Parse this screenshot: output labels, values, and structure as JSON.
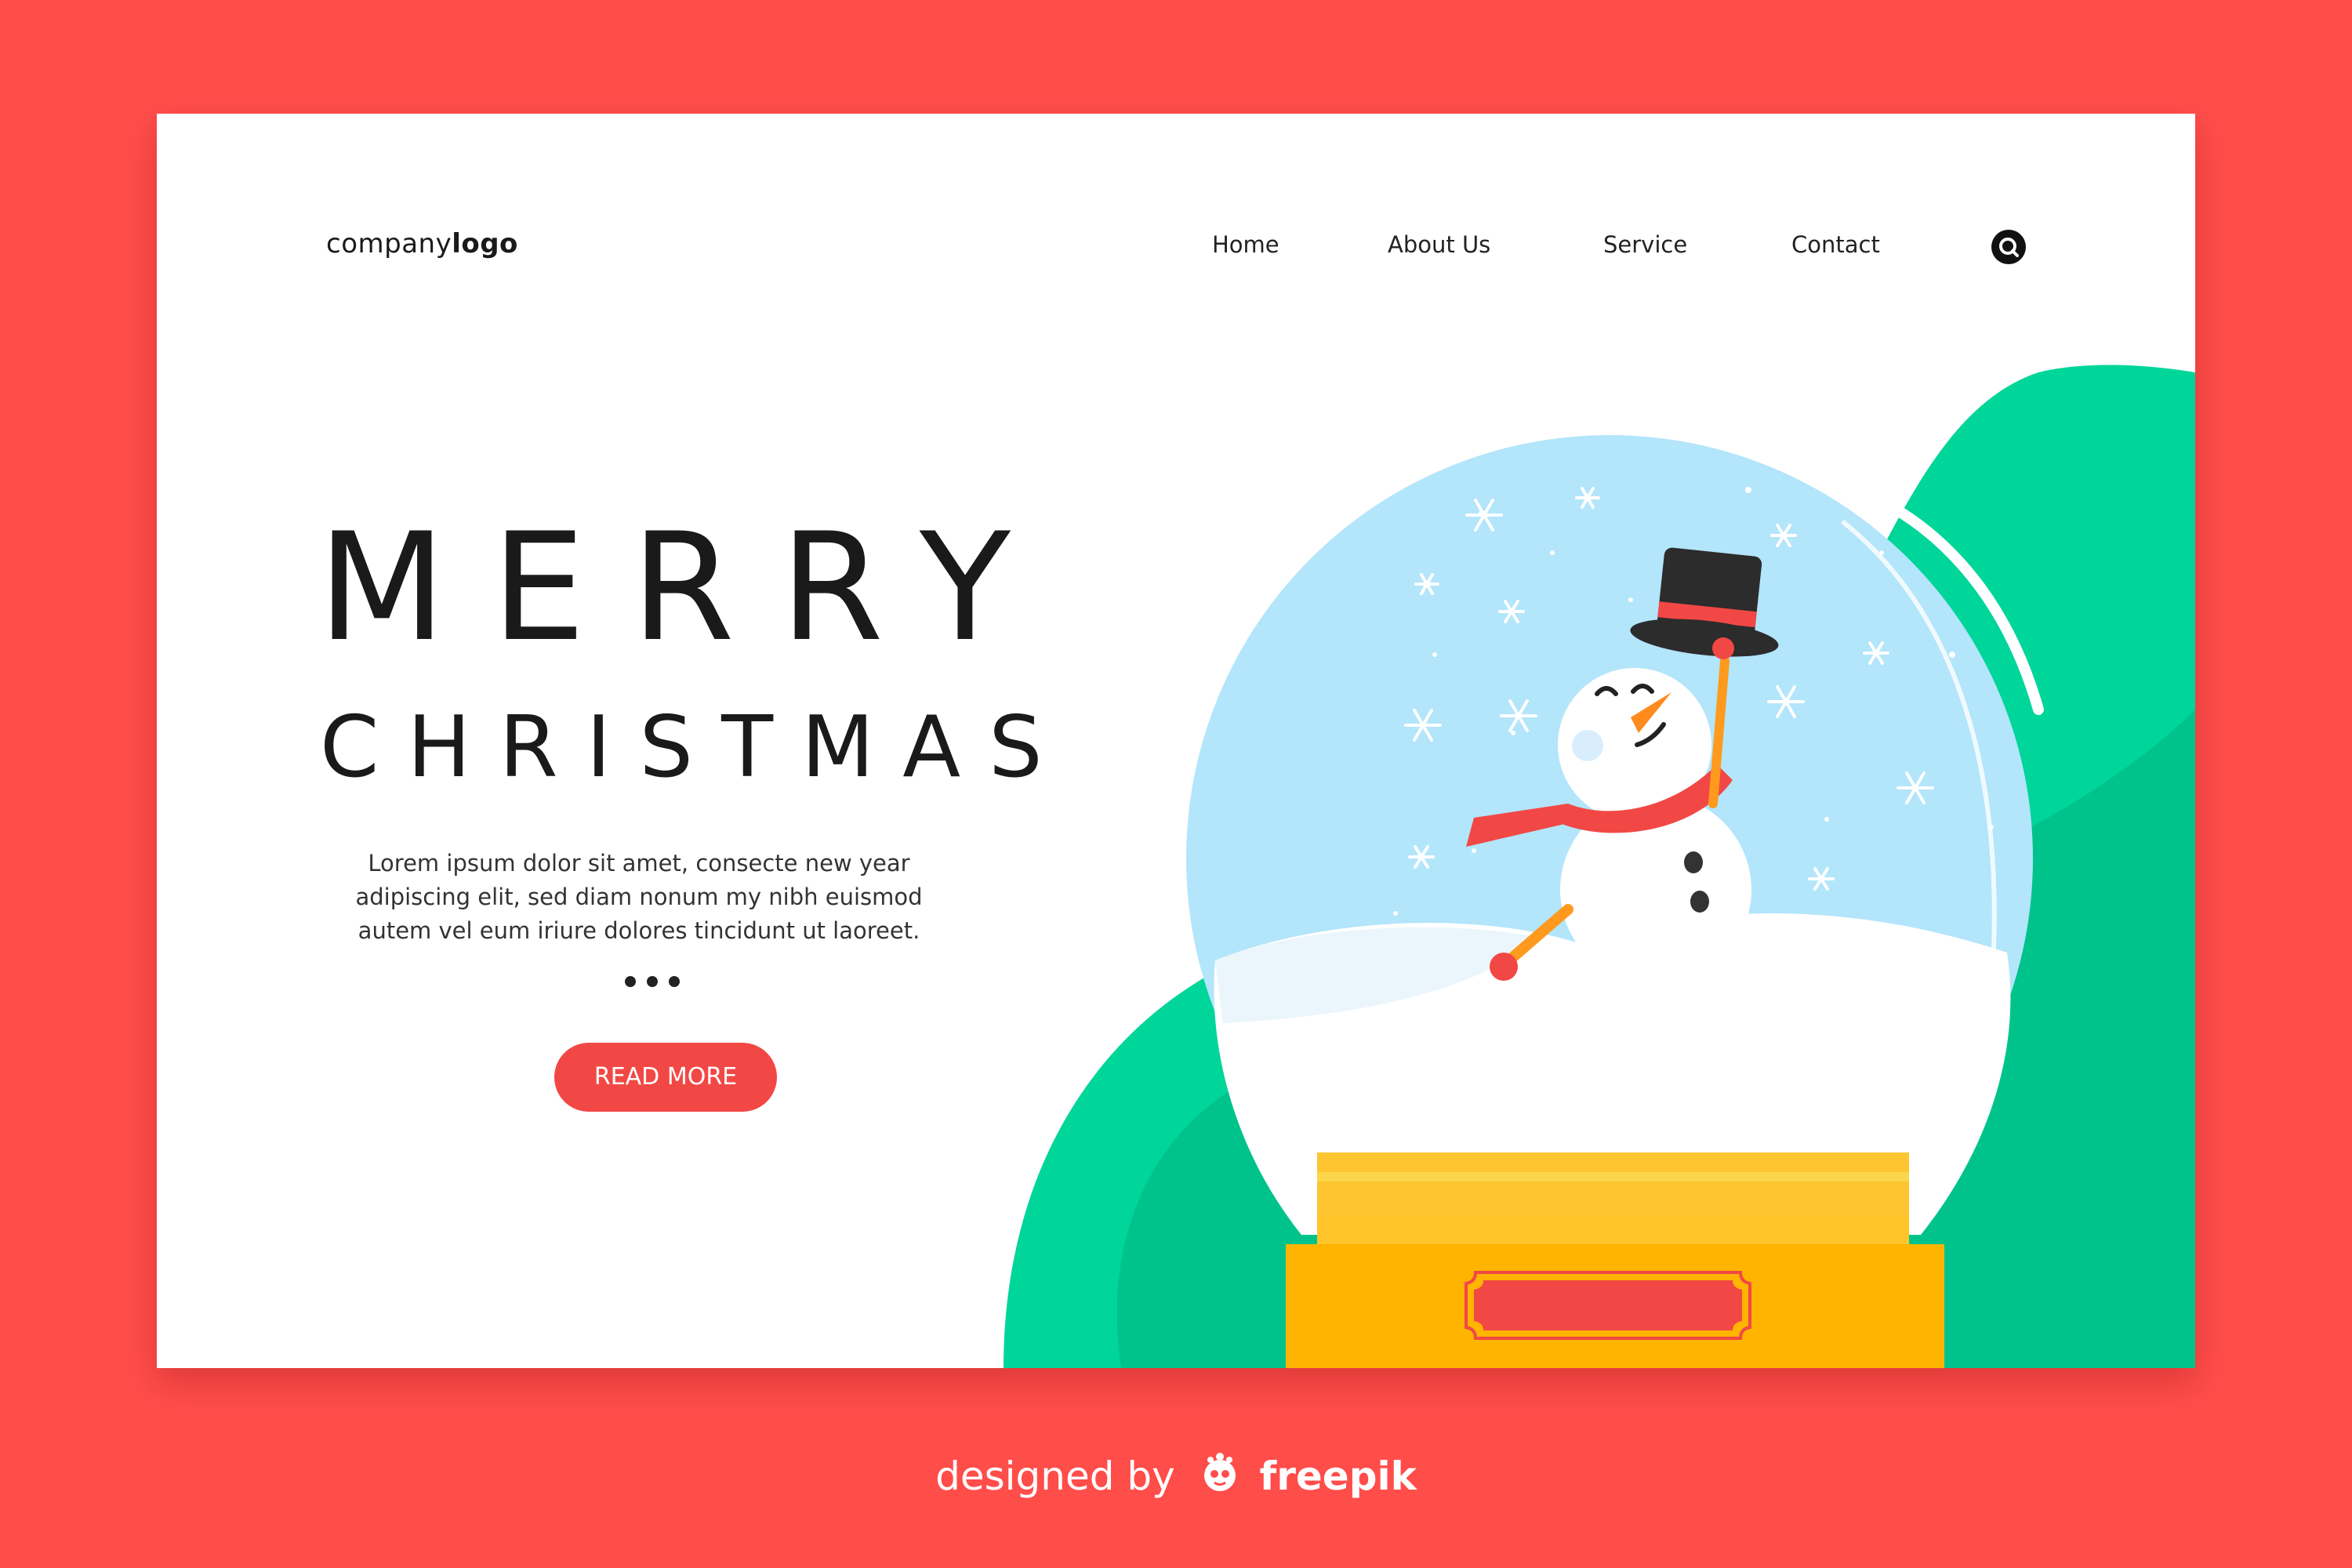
{
  "header": {
    "logo_prefix": "company",
    "logo_bold": "logo",
    "nav": [
      "Home",
      "About Us",
      "Service",
      "Contact"
    ],
    "search_icon": "search-icon"
  },
  "hero": {
    "title_line1": "MERRY",
    "title_line2": "CHRISTMAS",
    "body": "Lorem ipsum dolor sit amet, consecte new year adipiscing elit, sed diam nonum my nibh euismod autem vel eum iriure dolores tincidunt ut laoreet.",
    "button_label": "READ MORE",
    "illustration": "snow-globe-snowman"
  },
  "footer": {
    "designed_by": "designed by",
    "brand": "freepik"
  },
  "colors": {
    "background": "#ff4d4a",
    "card": "#ffffff",
    "accent": "#f24845",
    "green": "#00d59a",
    "globe": "#b3e5fb",
    "gold": "#fdc530"
  }
}
